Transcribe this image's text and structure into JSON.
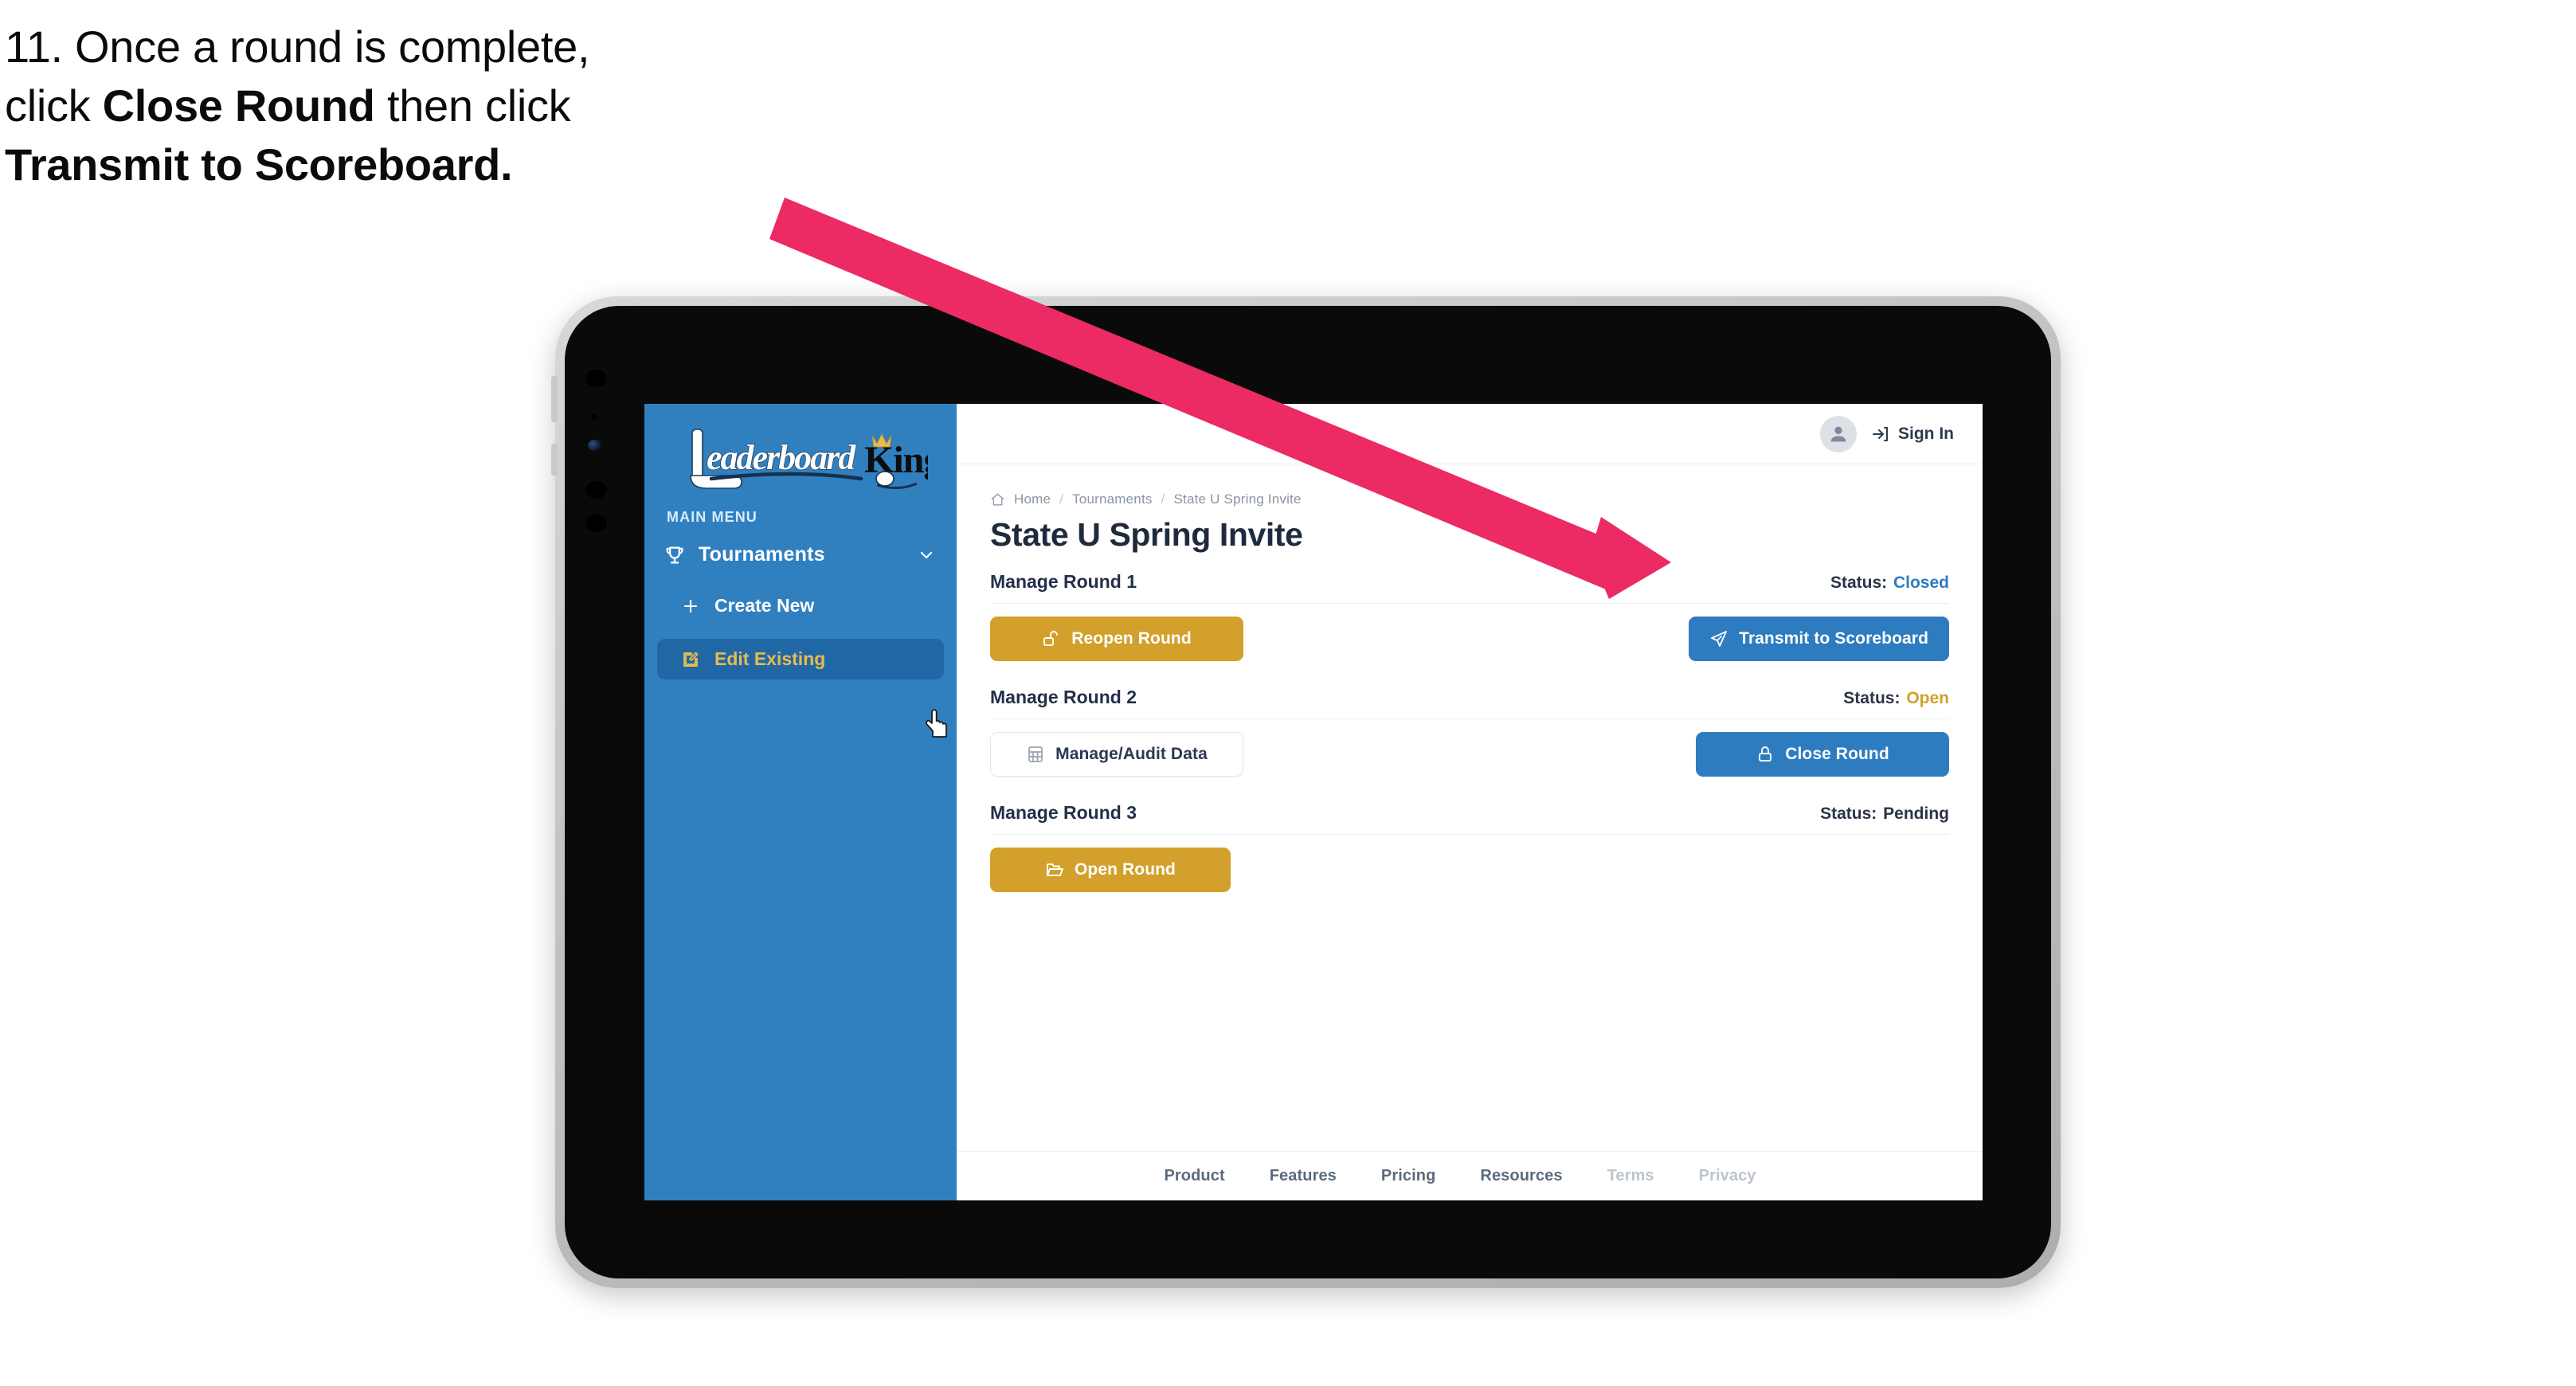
{
  "instruction": {
    "number": "11.",
    "line1_plain": "11. Once a round is complete,",
    "line2_pre": "click ",
    "line2_bold": "Close Round",
    "line2_post": " then click",
    "line3_bold": "Transmit to Scoreboard."
  },
  "annotation": {
    "arrow_color": "#ec2a63",
    "arrow_name": "pointer-arrow-to-transmit-button"
  },
  "device": {
    "frame_color": "#c2c2c2",
    "bezel_color": "#0a0a0a"
  },
  "sidebar": {
    "brand": {
      "word_one": "Leaderboard",
      "word_two": "King",
      "accent_color": "#e8bb52",
      "background": "#3080c0"
    },
    "section_label": "MAIN MENU",
    "groups": [
      {
        "label": "Tournaments",
        "icon": "trophy-icon",
        "chevron": "chevron-down-icon",
        "items": [
          {
            "label": "Create New",
            "icon": "plus-icon",
            "active": false
          },
          {
            "label": "Edit Existing",
            "icon": "pencil-square-icon",
            "active": true
          }
        ]
      }
    ],
    "cursor": "hand-pointer-cursor"
  },
  "topbar": {
    "avatar_icon": "user-avatar-icon",
    "signin_icon": "sign-in-arrow-icon",
    "signin_label": "Sign In"
  },
  "breadcrumb": {
    "home_icon": "home-icon",
    "items": [
      "Home",
      "Tournaments",
      "State U Spring Invite"
    ],
    "separator": "/"
  },
  "page_title": "State U Spring Invite",
  "rounds": [
    {
      "title": "Manage Round 1",
      "status_label": "Status:",
      "status_value": "Closed",
      "status_color": "#2e7cc0",
      "left_button": {
        "label": "Reopen Round",
        "icon": "unlock-icon",
        "style": "gold"
      },
      "right_button": {
        "label": "Transmit to Scoreboard",
        "icon": "paper-plane-icon",
        "style": "blue"
      }
    },
    {
      "title": "Manage Round 2",
      "status_label": "Status:",
      "status_value": "Open",
      "status_color": "#d2a02b",
      "left_button": {
        "label": "Manage/Audit Data",
        "icon": "table-grid-icon",
        "style": "ghost"
      },
      "right_button": {
        "label": "Close Round",
        "icon": "lock-icon",
        "style": "blue"
      }
    },
    {
      "title": "Manage Round 3",
      "status_label": "Status:",
      "status_value": "Pending",
      "status_color": "#2b3446",
      "left_button": {
        "label": "Open Round",
        "icon": "folder-open-icon",
        "style": "gold"
      },
      "right_button": null
    }
  ],
  "footer": {
    "links": [
      {
        "label": "Product",
        "muted": false
      },
      {
        "label": "Features",
        "muted": false
      },
      {
        "label": "Pricing",
        "muted": false
      },
      {
        "label": "Resources",
        "muted": false
      },
      {
        "label": "Terms",
        "muted": true
      },
      {
        "label": "Privacy",
        "muted": true
      }
    ]
  }
}
